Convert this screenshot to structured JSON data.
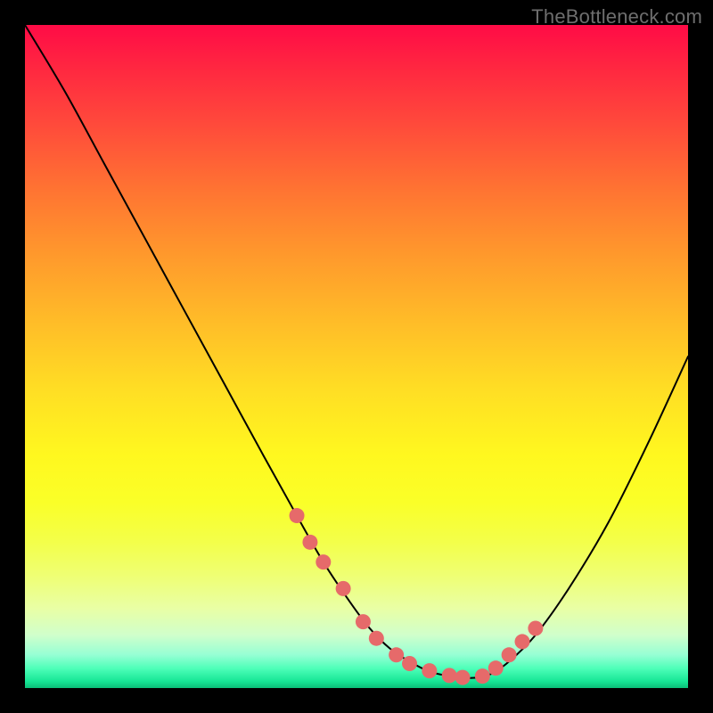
{
  "watermark": "TheBottleneck.com",
  "chart_data": {
    "type": "line",
    "title": "",
    "xlabel": "",
    "ylabel": "",
    "xlim": [
      0,
      100
    ],
    "ylim": [
      0,
      100
    ],
    "series": [
      {
        "name": "bottleneck-curve",
        "x": [
          0,
          6,
          12,
          18,
          24,
          30,
          36,
          41,
          45,
          49,
          52,
          55,
          58,
          61,
          64,
          67,
          70,
          73,
          77,
          82,
          88,
          94,
          100
        ],
        "values": [
          100,
          90,
          79,
          68,
          57,
          46,
          35,
          26,
          19,
          13,
          9,
          6,
          4,
          2.5,
          1.8,
          1.5,
          2,
          4,
          8,
          15,
          25,
          37,
          50
        ]
      }
    ],
    "markers": {
      "name": "highlight-dots",
      "x": [
        41,
        43,
        45,
        48,
        51,
        53,
        56,
        58,
        61,
        64,
        66,
        69,
        71,
        73,
        75,
        77
      ],
      "values": [
        26,
        22,
        19,
        15,
        10,
        7.5,
        5,
        3.7,
        2.6,
        1.9,
        1.6,
        1.8,
        3,
        5,
        7,
        9
      ]
    },
    "background_gradient": {
      "top": "#ff0b46",
      "mid": "#fff81f",
      "bottom": "#0bbf78"
    }
  }
}
